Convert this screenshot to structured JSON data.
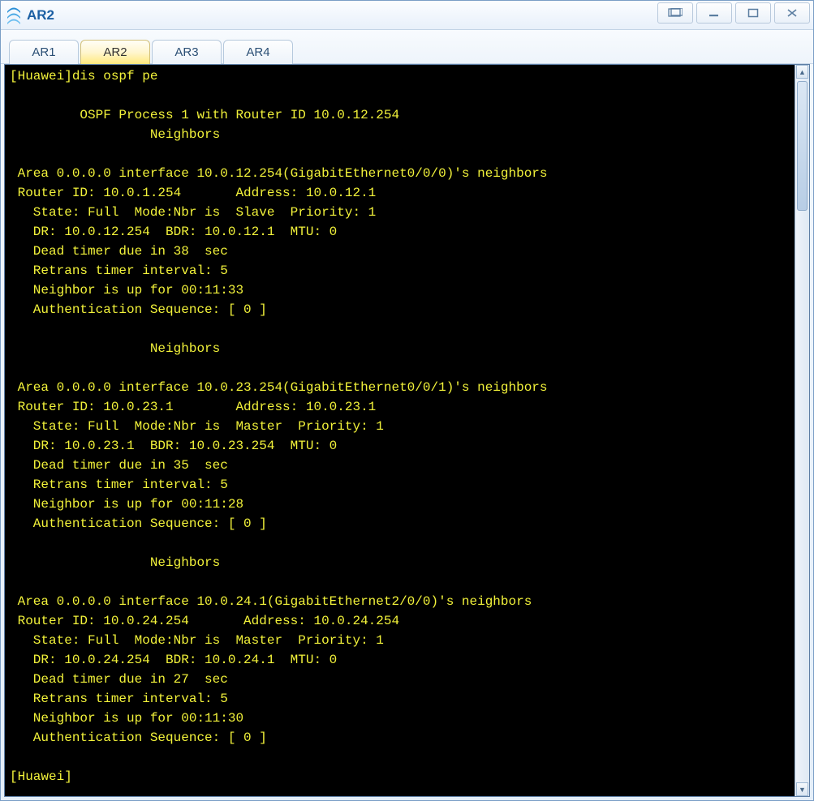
{
  "window": {
    "title": "AR2"
  },
  "tabs": {
    "items": [
      {
        "label": "AR1",
        "active": false
      },
      {
        "label": "AR2",
        "active": true
      },
      {
        "label": "AR3",
        "active": false
      },
      {
        "label": "AR4",
        "active": false
      }
    ]
  },
  "terminal": {
    "prompt_line": "[Huawei]dis ospf pe",
    "header_line1": "         OSPF Process 1 with Router ID 10.0.12.254",
    "header_line2": "                  Neighbors ",
    "blocks": [
      {
        "area_line": " Area 0.0.0.0 interface 10.0.12.254(GigabitEthernet0/0/0)'s neighbors",
        "router_line": " Router ID: 10.0.1.254       Address: 10.0.12.1        ",
        "state_line": "   State: Full  Mode:Nbr is  Slave  Priority: 1",
        "dr_line": "   DR: 10.0.12.254  BDR: 10.0.12.1  MTU: 0    ",
        "dead_line": "   Dead timer due in 38  sec ",
        "retrans_line": "   Retrans timer interval: 5 ",
        "up_line": "   Neighbor is up for 00:11:33     ",
        "auth_line": "   Authentication Sequence: [ 0 ] "
      },
      {
        "area_line": " Area 0.0.0.0 interface 10.0.23.254(GigabitEthernet0/0/1)'s neighbors",
        "router_line": " Router ID: 10.0.23.1        Address: 10.0.23.1         ",
        "state_line": "   State: Full  Mode:Nbr is  Master  Priority: 1",
        "dr_line": "   DR: 10.0.23.1  BDR: 10.0.23.254  MTU: 0    ",
        "dead_line": "   Dead timer due in 35  sec ",
        "retrans_line": "   Retrans timer interval: 5 ",
        "up_line": "   Neighbor is up for 00:11:28     ",
        "auth_line": "   Authentication Sequence: [ 0 ] "
      },
      {
        "area_line": " Area 0.0.0.0 interface 10.0.24.1(GigabitEthernet2/0/0)'s neighbors",
        "router_line": " Router ID: 10.0.24.254       Address: 10.0.24.254       ",
        "state_line": "   State: Full  Mode:Nbr is  Master  Priority: 1",
        "dr_line": "   DR: 10.0.24.254  BDR: 10.0.24.1  MTU: 0    ",
        "dead_line": "   Dead timer due in 27  sec ",
        "retrans_line": "   Retrans timer interval: 5 ",
        "up_line": "   Neighbor is up for 00:11:30     ",
        "auth_line": "   Authentication Sequence: [ 0 ] "
      }
    ],
    "neighbors_sep": "                  Neighbors ",
    "end_prompt": "[Huawei]"
  }
}
